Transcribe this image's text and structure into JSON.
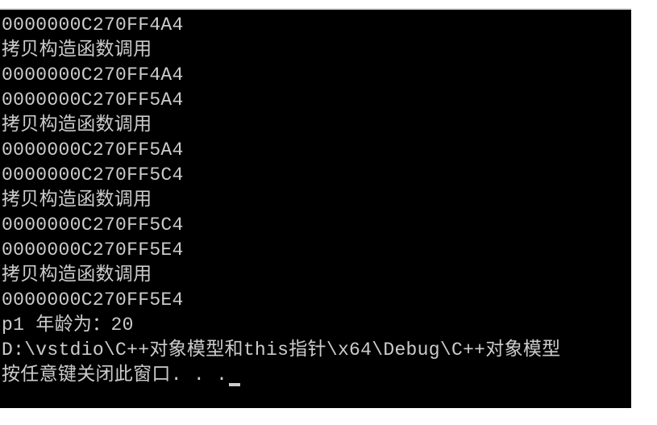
{
  "console": {
    "lines": [
      "0000000C270FF4A4",
      "拷贝构造函数调用",
      "0000000C270FF4A4",
      "0000000C270FF5A4",
      "拷贝构造函数调用",
      "0000000C270FF5A4",
      "0000000C270FF5C4",
      "拷贝构造函数调用",
      "0000000C270FF5C4",
      "0000000C270FF5E4",
      "拷贝构造函数调用",
      "0000000C270FF5E4",
      "p1 年龄为：20",
      "D:\\vstdio\\C++对象模型和this指针\\x64\\Debug\\C++对象模型",
      "按任意键关闭此窗口. . ."
    ]
  }
}
